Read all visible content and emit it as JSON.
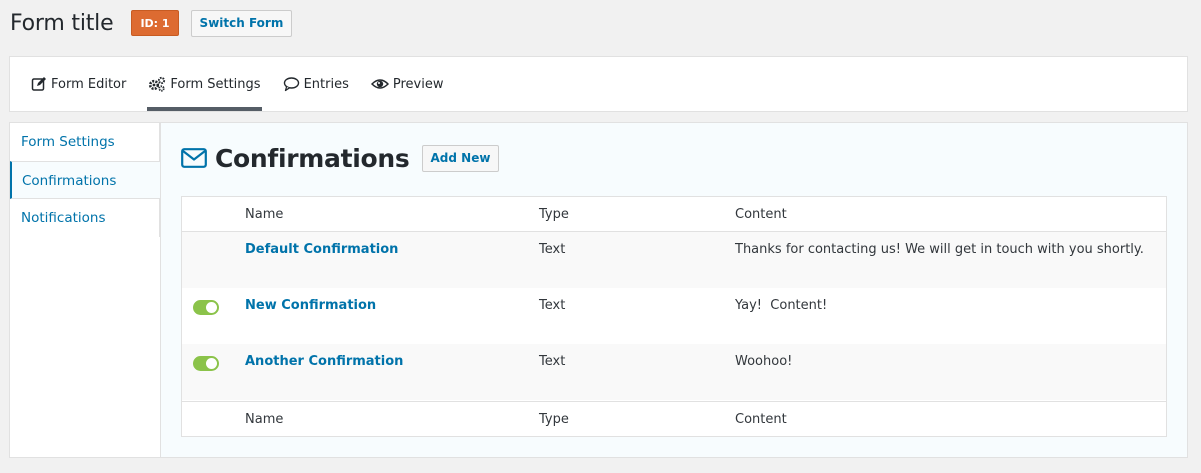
{
  "header": {
    "title": "Form title",
    "id_badge": "ID: 1",
    "switch_label": "Switch Form"
  },
  "tabs": [
    {
      "label": "Form Editor",
      "icon": "edit-icon"
    },
    {
      "label": "Form Settings",
      "icon": "gears-icon",
      "active": true
    },
    {
      "label": "Entries",
      "icon": "comment-icon"
    },
    {
      "label": "Preview",
      "icon": "eye-icon"
    }
  ],
  "sidenav": [
    {
      "label": "Form Settings"
    },
    {
      "label": "Confirmations",
      "active": true
    },
    {
      "label": "Notifications"
    }
  ],
  "main": {
    "title": "Confirmations",
    "title_icon": "envelope-icon",
    "add_new_label": "Add New"
  },
  "table": {
    "columns": [
      "Name",
      "Type",
      "Content"
    ],
    "rows": [
      {
        "name": "Default Confirmation",
        "type": "Text",
        "content": "Thanks for contacting us! We will get in touch with you shortly.",
        "toggle": null
      },
      {
        "name": "New Confirmation",
        "type": "Text",
        "content": "Yay!  Content!",
        "toggle": "on"
      },
      {
        "name": "Another Confirmation",
        "type": "Text",
        "content": "Woohoo!",
        "toggle": "on"
      }
    ]
  },
  "colors": {
    "accent": "#0073aa",
    "badge": "#dd6b31",
    "toggle_on": "#8bc34a"
  }
}
